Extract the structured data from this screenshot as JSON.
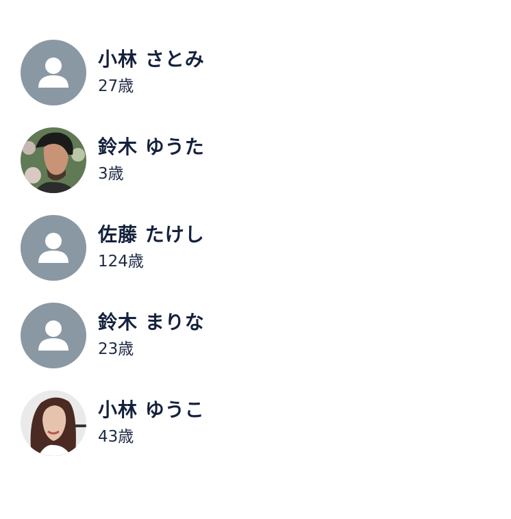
{
  "colors": {
    "placeholder_bg": "#8a98a3",
    "placeholder_fg": "#ffffff",
    "name_text": "#14213d",
    "age_text": "#1e2a44"
  },
  "users": [
    {
      "name": "小林 さとみ",
      "age": "27歳",
      "avatar": "person-placeholder-icon"
    },
    {
      "name": "鈴木 ゆうた",
      "age": "3歳",
      "avatar": "photo-man"
    },
    {
      "name": "佐藤 たけし",
      "age": "124歳",
      "avatar": "person-placeholder-icon"
    },
    {
      "name": "鈴木 まりな",
      "age": "23歳",
      "avatar": "person-placeholder-icon"
    },
    {
      "name": "小林 ゆうこ",
      "age": "43歳",
      "avatar": "photo-woman"
    }
  ]
}
